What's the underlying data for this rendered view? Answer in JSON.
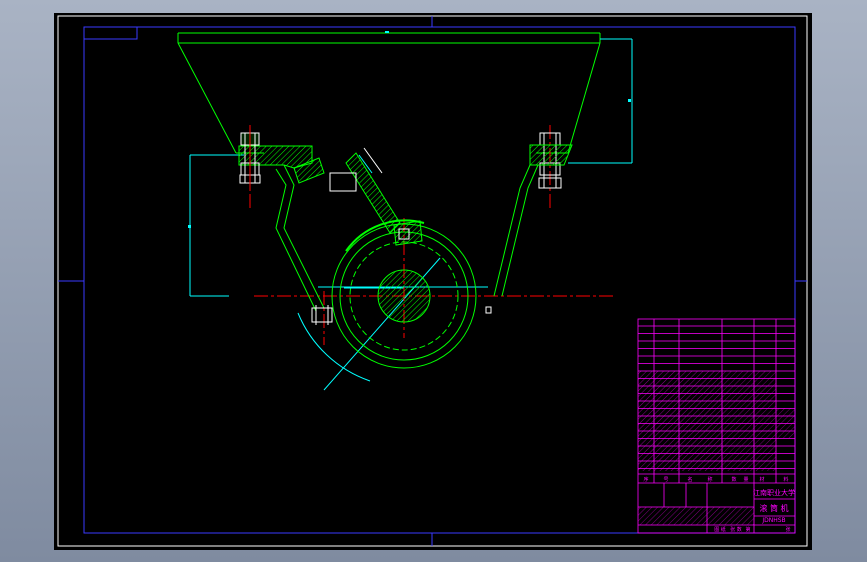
{
  "title_block": {
    "company": "江南职业大学",
    "drawing_name": "滚 筒 机",
    "drawing_number": "JDNHSB",
    "header_labels": [
      "序",
      "号",
      "名",
      "称",
      "数",
      "量",
      "材",
      "料"
    ],
    "footer_labels": [
      "图 纸",
      "张 数",
      "第",
      "张"
    ]
  },
  "colors": {
    "background": "#000000",
    "frame": "#0000ff",
    "outline": "#00ff00",
    "dimension": "#00ffff",
    "centerline": "#ff0000",
    "hatch": "#00ff00",
    "bolt": "#ffffff",
    "title_block": "#ff00ff"
  },
  "icons": [
    "drawing-sheet",
    "hopper-outline",
    "drum-circle",
    "bolt-assembly",
    "title-block"
  ]
}
